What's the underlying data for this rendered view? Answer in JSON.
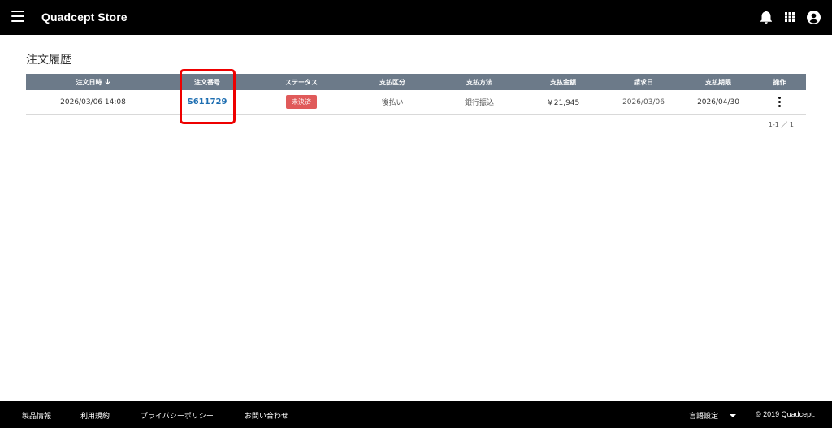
{
  "header": {
    "title": "Quadcept Store",
    "icons": [
      "menu-icon",
      "bell-icon",
      "apps-grid-icon",
      "account-circle-icon"
    ]
  },
  "page": {
    "title": "注文履歴"
  },
  "table": {
    "headers": [
      "注文日時",
      "注文番号",
      "ステータス",
      "支払区分",
      "支払方法",
      "支払金額",
      "請求日",
      "支払期限",
      "操作"
    ],
    "sort_icon": "arrow-down-icon",
    "rows": [
      {
        "order_datetime": "2026/03/06 14:08",
        "order_number": "S611729",
        "status": "未決済",
        "payment_type": "後払い",
        "payment_method": "銀行振込",
        "amount": "￥21,945",
        "billing_date": "2026/03/06",
        "due_date": "2026/04/30",
        "action_icon": "more-vert-icon"
      }
    ]
  },
  "pagination": {
    "text": "1-1 ／ 1"
  },
  "footer": {
    "links": [
      "製品情報",
      "利用規約",
      "プライバシーポリシー",
      "お問い合わせ"
    ],
    "language": "言語設定",
    "copyright": "© 2019 Quadcept."
  },
  "colors": {
    "header_bg": "#000000",
    "table_header_bg": "#6c7a89",
    "status_badge": "#e05a5a",
    "link": "#1f6fb2",
    "highlight": "#ee0000"
  }
}
